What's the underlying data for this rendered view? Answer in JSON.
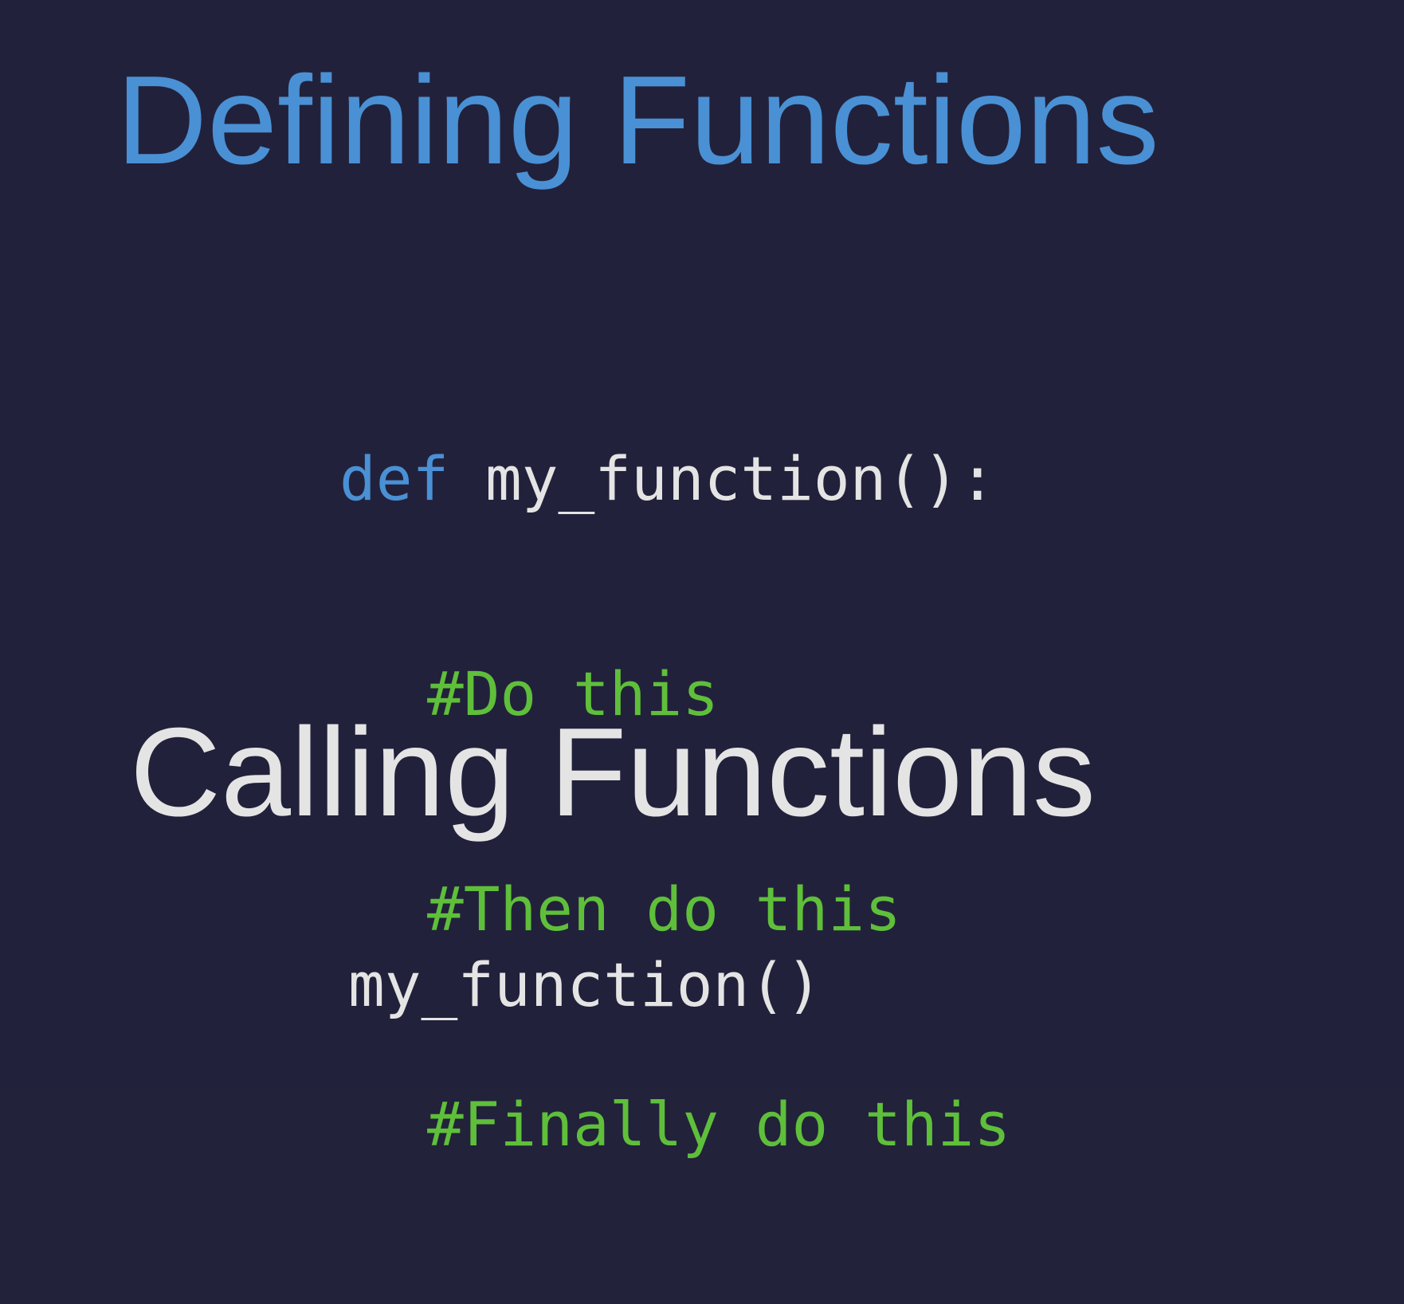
{
  "colors": {
    "background": "#22213b",
    "heading_defining": "#4a90d4",
    "heading_calling": "#e4e4e4",
    "keyword": "#4a90d4",
    "code_text": "#e4e4e4",
    "comment": "#5fbf3a"
  },
  "slide": {
    "defining_title": "Defining Functions",
    "definition_code": {
      "keyword": "def",
      "signature": " my_function():",
      "comments": [
        "#Do this",
        "#Then do this",
        "#Finally do this"
      ]
    },
    "calling_title": "Calling Functions",
    "call_code": "my_function()"
  }
}
